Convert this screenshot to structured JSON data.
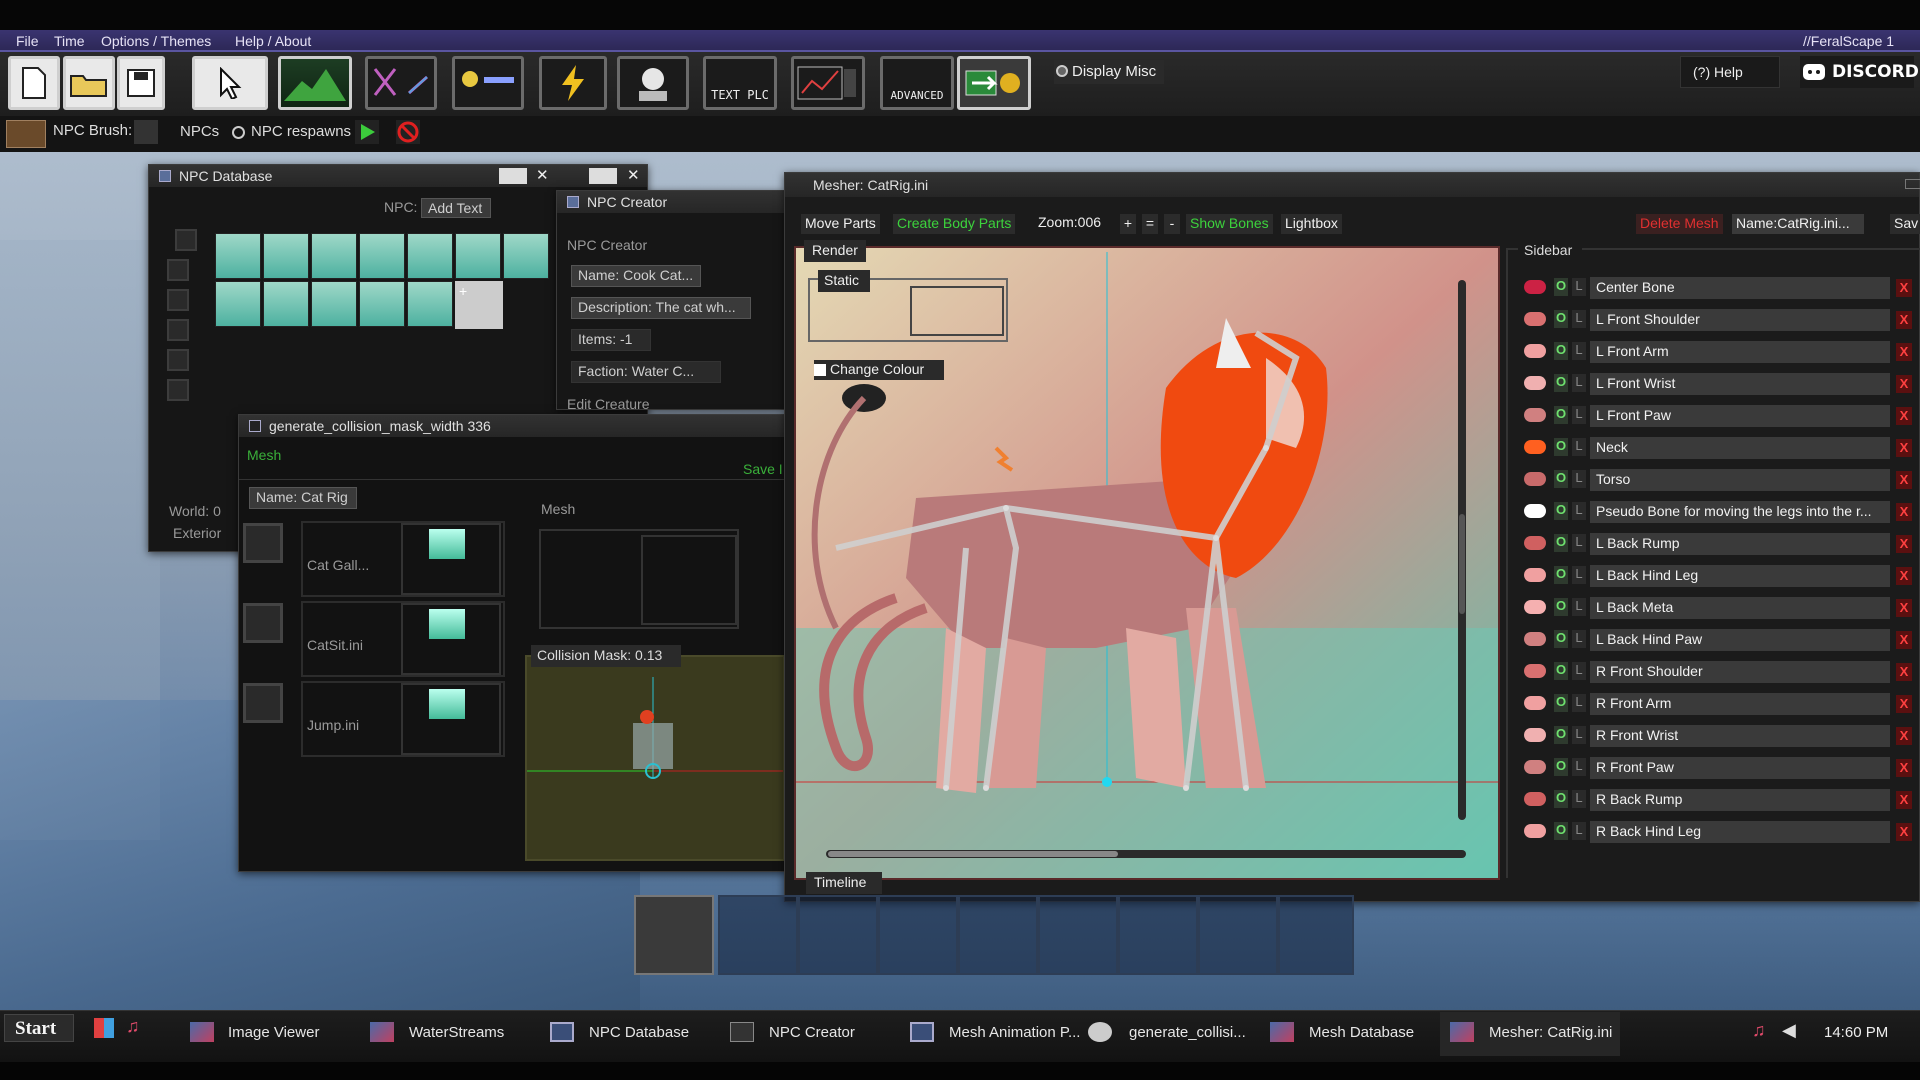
{
  "menu": {
    "items": [
      "File",
      "Time",
      "Options / Themes",
      "Help / About"
    ],
    "right": "//FeralScape 1"
  },
  "toolbar": {
    "display_misc": "Display Misc",
    "help": "(?) Help",
    "discord": "DISCORD",
    "text_plc": "TEXT PLC",
    "advanced": "ADVANCED"
  },
  "toolbar2": {
    "npc_brush": "NPC Brush:",
    "npcs": "NPCs",
    "npc_respawns": "NPC respawns"
  },
  "npc_db": {
    "title": "NPC Database",
    "npc_label": "NPC:",
    "add_text": "Add Text",
    "world": "World: 0",
    "exterior": "Exterior"
  },
  "npc_creator": {
    "title": "NPC Creator",
    "heading": "NPC Creator",
    "name": "Name: Cook Cat...",
    "description": "Description: The cat wh...",
    "items": "Items: -1",
    "faction": "Faction: Water C...",
    "edit": "Edit Creature"
  },
  "collision": {
    "title": "generate_collision_mask_width 336",
    "mesh_tab": "Mesh",
    "save": "Save I",
    "name": "Name: Cat Rig",
    "mesh_label": "Mesh",
    "collision_mask": "Collision Mask: 0.13",
    "anims": [
      {
        "label": "Cat Gall..."
      },
      {
        "label": "CatSit.ini"
      },
      {
        "label": "Jump.ini"
      }
    ]
  },
  "mesher": {
    "title": "Mesher: CatRig.ini",
    "move_parts": "Move Parts",
    "create_body_parts": "Create Body Parts",
    "zoom": "Zoom:006",
    "plus": "+",
    "eq": "=",
    "minus": "-",
    "show_bones": "Show Bones",
    "lightbox": "Lightbox",
    "delete_mesh": "Delete Mesh",
    "name": "Name:CatRig.ini...",
    "save": "Sav",
    "render": "Render",
    "static": "Static",
    "change_colour": "Change Colour",
    "timeline": "Timeline",
    "sidebar": "Sidebar",
    "parts": [
      {
        "name": "Center Bone",
        "color": "#cc2244"
      },
      {
        "name": "L Front Shoulder",
        "color": "#d97070"
      },
      {
        "name": "L Front Arm",
        "color": "#f0a0a0"
      },
      {
        "name": "L Front Wrist",
        "color": "#f0b0b0"
      },
      {
        "name": "L Front Paw",
        "color": "#d08080"
      },
      {
        "name": "Neck",
        "color": "#ff6020"
      },
      {
        "name": "Torso",
        "color": "#c86a6a"
      },
      {
        "name": "Pseudo Bone for moving the legs into the r...",
        "color": "#ffffff"
      },
      {
        "name": "L Back Rump",
        "color": "#d06060"
      },
      {
        "name": "L Back Hind Leg",
        "color": "#f0a0a0"
      },
      {
        "name": "L Back Meta",
        "color": "#f5b0b0"
      },
      {
        "name": "L Back Hind Paw",
        "color": "#d08080"
      },
      {
        "name": "R Front Shoulder",
        "color": "#d97070"
      },
      {
        "name": "R Front Arm",
        "color": "#f0a0a0"
      },
      {
        "name": "R Front Wrist",
        "color": "#f0b0b0"
      },
      {
        "name": "R Front Paw",
        "color": "#d08080"
      },
      {
        "name": "R Back Rump",
        "color": "#d06060"
      },
      {
        "name": "R Back Hind Leg",
        "color": "#f0a0a0"
      }
    ]
  },
  "taskbar": {
    "start": "Start",
    "time": "14:60 PM",
    "tasks": [
      "Image Viewer",
      "WaterStreams",
      "NPC Database",
      "NPC Creator",
      "Mesh Animation P...",
      "generate_collisi...",
      "Mesh Database",
      "Mesher: CatRig.ini"
    ]
  }
}
